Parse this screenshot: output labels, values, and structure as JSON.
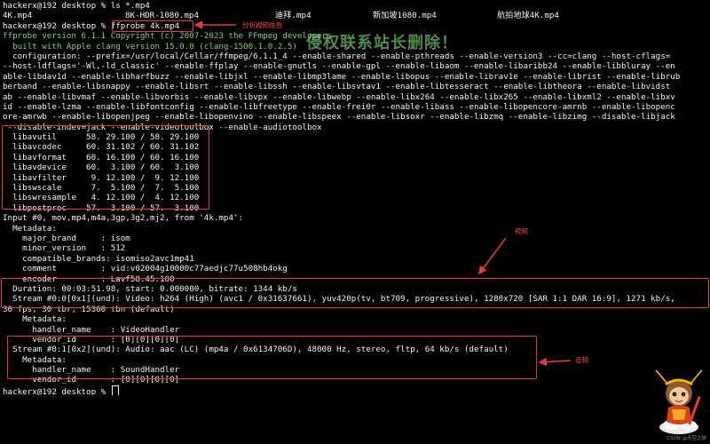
{
  "terminal": {
    "prompt_ls": "hackerx@192 desktop % ls *.mp4",
    "files": [
      "4K.mp4",
      "8K-HDR-1080.mp4",
      "迪拜.mp4",
      "新加坡1080.mp4",
      "航拍地球4K.mp4"
    ],
    "prompt_prefix": "hackerx@192 desktop % ",
    "command": "ffprobe 4k.mp4",
    "version_line": "ffprobe version 6.1.1 Copyright (c) 2007-2023 the FFmpeg developers",
    "build_line": "  built with Apple clang version 15.0.0 (clang-1500.1.0.2.5)",
    "config_lines": [
      "  configuration: --prefix=/usr/local/Cellar/ffmpeg/6.1.1_4 --enable-shared --enable-pthreads --enable-version3 --cc=clang --host-cflags=",
      "--host-ldflags='-Wl,-ld_classic' --enable-ffplay --enable-gnutls --enable-gpl --enable-libaom --enable-libaribb24 --enable-libbluray --en",
      "able-libdav1d --enable-libharfbuzz --enable-libjxl --enable-libmp3lame --enable-libopus --enable-librav1e --enable-librist --enable-librub",
      "berband --enable-libsnappy --enable-libsrt --enable-libssh --enable-libsvtav1 --enable-libtesseract --enable-libtheora --enable-libvidst",
      "ab --enable-libvmaf --enable-libvorbis --enable-libvpx --enable-libwebp --enable-libx264 --enable-libx265 --enable-libxml2 --enable-libxv",
      "id --enable-lzma --enable-libfontconfig --enable-libfreetype --enable-frei0r --enable-libass --enable-libopencore-amrnb --enable-libopenc",
      "ore-amrwb --enable-libopenjpeg --enable-libopenvino --enable-libspeex --enable-libsoxr --enable-libzmq --enable-libzimg --disable-libjack",
      " --disable-indev=jack --enable-videotoolbox --enable-audiotoolbox"
    ],
    "lib_lines": [
      "  libavutil      58. 29.100 / 58. 29.100",
      "  libavcodec     60. 31.102 / 60. 31.102",
      "  libavformat    60. 16.100 / 60. 16.100",
      "  libavdevice    60.  3.100 / 60.  3.100",
      "  libavfilter     9. 12.100 /  9. 12.100",
      "  libswscale      7.  5.100 /  7.  5.100",
      "  libswresample   4. 12.100 /  4. 12.100",
      "  libpostproc    57.  3.100 / 57.  3.100"
    ],
    "input_line": "Input #0, mov,mp4,m4a,3gp,3g2,mj2, from '4k.mp4':",
    "metadata_line": "  Metadata:",
    "meta_lines": [
      "    major_brand     : isom",
      "    minor_version   : 512",
      "    compatible_brands: isomiso2avc1mp41",
      "    comment         : vid:v02004g10000c77aedjc77u508hb4okg",
      "    encoder         : Lavf58.45.100"
    ],
    "duration_line": "  Duration: 00:03:51.98, start: 0.000000, bitrate: 1344 kb/s",
    "video_stream_line": "  Stream #0:0[0x1](und): Video: h264 (High) (avc1 / 0x31637661), yuv420p(tv, bt709, progressive), 1280x720 [SAR 1:1 DAR 16:9], 1271 kb/s,",
    "video_stream_cont": "30 fps, 30 tbr, 15360 tbn (default)",
    "video_meta": [
      "    Metadata:",
      "      handler_name    : VideoHandler",
      "      vendor_id       : [0][0][0][0]"
    ],
    "audio_stream_line": "  Stream #0:1[0x2](und): Audio: aac (LC) (mp4a / 0x6134706D), 48000 Hz, stereo, fltp, 64 kb/s (default)",
    "audio_meta": [
      "    Metadata:",
      "      handler_name    : SoundHandler",
      "      vendor_id       : [0][0][0][0]"
    ],
    "final_prompt": "hackerx@192 desktop % "
  },
  "annotations": {
    "analyze_label": "分析视频信息",
    "video_label": "视频",
    "audio_label": "音频",
    "watermark": "侵权联系站长删除！",
    "credit": "CSDN @天空之城"
  },
  "colors": {
    "background": "#000000",
    "text": "#f2f2f2",
    "highlight_green": "#7ed47e",
    "annotation_red": "#e53935"
  }
}
